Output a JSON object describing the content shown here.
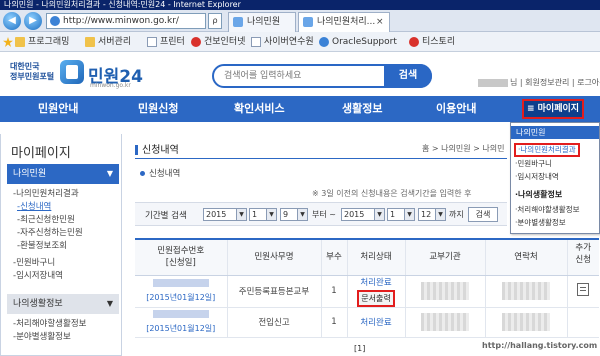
{
  "browser": {
    "title": "나의민원 - 나의민원처리결과 - 신청내역:민원24 - Internet Explorer",
    "url": "http://www.minwon.go.kr/",
    "url_mini": "ρ",
    "back_glyph": "◀",
    "fwd_glyph": "▶",
    "tabs": [
      {
        "label": "나의민원"
      },
      {
        "label": "나의민원처리...",
        "close": "×"
      }
    ],
    "favorites": [
      {
        "label": "프로그래밍",
        "icon": "folder-icon"
      },
      {
        "label": "서버관리",
        "icon": "folder-icon"
      },
      {
        "label": "프린터",
        "icon": "page-icon"
      },
      {
        "label": "건보인터넷",
        "icon": "red-circle-icon"
      },
      {
        "label": "사이버연수원",
        "icon": "page-icon"
      },
      {
        "label": "OracleSupport",
        "icon": "blue-circle-icon"
      },
      {
        "label": "티스토리",
        "icon": "red-circle-icon"
      }
    ]
  },
  "site": {
    "logo_gov_line1": "대한민국",
    "logo_gov_line2": "정부민원포털",
    "logo_name": "민원24",
    "logo_domain": "minwon.go.kr",
    "search_placeholder": "검색어를 입력하세요",
    "search_button": "검색",
    "user_links": "님 | 회원정보관리 | 로그아웃"
  },
  "gnb": {
    "items": [
      "민원안내",
      "민원신청",
      "확인서비스",
      "생활정보",
      "이용안내"
    ],
    "mypage_icon": "≡",
    "mypage": "마이페이지"
  },
  "dropdown": {
    "header": "나의민원",
    "items1": [
      "나의민원처리결과",
      "민원바구니",
      "임시저장내역"
    ],
    "cat2": "나의생활정보",
    "items2": [
      "처리해야할생활정보",
      "분야별생활정보"
    ],
    "bullet": "·"
  },
  "sidebar": {
    "title": "마이페이지",
    "cat1": "나의민원",
    "cat1_glyph": "▼",
    "cat1_links": [
      "나의민원처리결과",
      "신청내역",
      "최근신청한민원",
      "자주신청하는민원",
      "환불정보조회",
      "민원바구니",
      "임시저장내역"
    ],
    "cat2": "나의생활정보",
    "cat2_glyph": "▼",
    "cat2_links": [
      "처리해야할생활정보",
      "분야별생활정보"
    ],
    "dash": "-"
  },
  "content": {
    "title": "신청내역",
    "breadcrumb": "홈 > 나의민원 > 나의민",
    "sub_title": "신청내역",
    "notice": "※ 3일 이전의 신청내용은 검색기간을 입력한 후",
    "filter": {
      "label": "기간별 검색",
      "from_year": "2015",
      "from_month": "1",
      "from_day": "9",
      "to_label": "부터 ~",
      "to_year": "2015",
      "to_month": "1",
      "to_day": "12",
      "until_label": "까지",
      "search": "검색",
      "arrow": "▼"
    },
    "table": {
      "headers": [
        "민원접수번호\n[신청일]",
        "민원사무명",
        "부수",
        "처리상태",
        "교부기관",
        "연락처",
        "추가\n신청"
      ],
      "rows": [
        {
          "date": "[2015년01월12일]",
          "name": "주민등록표등본교부",
          "copies": "1",
          "status": "처리완료",
          "action": "문서출력"
        },
        {
          "date": "[2015년01월12일]",
          "name": "전입신고",
          "copies": "1",
          "status": "처리완료",
          "action": ""
        }
      ]
    },
    "pager": "[1]",
    "watermark": "http://hallang.tistory.com"
  }
}
